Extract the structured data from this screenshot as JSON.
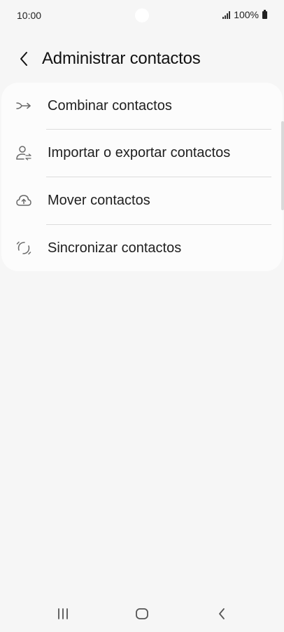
{
  "status_bar": {
    "time": "10:00",
    "battery": "100%"
  },
  "header": {
    "title": "Administrar contactos",
    "back_icon": "chevron-left-icon"
  },
  "menu": {
    "items": [
      {
        "label": "Combinar contactos",
        "icon": "merge-arrow-icon"
      },
      {
        "label": "Importar o exportar contactos",
        "icon": "person-transfer-icon"
      },
      {
        "label": "Mover contactos",
        "icon": "cloud-upload-icon"
      },
      {
        "label": "Sincronizar contactos",
        "icon": "sync-icon"
      }
    ]
  },
  "nav_bar": {
    "recents_icon": "recents-icon",
    "home_icon": "home-icon",
    "back_icon": "back-icon"
  },
  "colors": {
    "background": "#f6f6f6",
    "card": "#fcfcfc",
    "text": "#202020",
    "icon": "#6a6a6a"
  }
}
